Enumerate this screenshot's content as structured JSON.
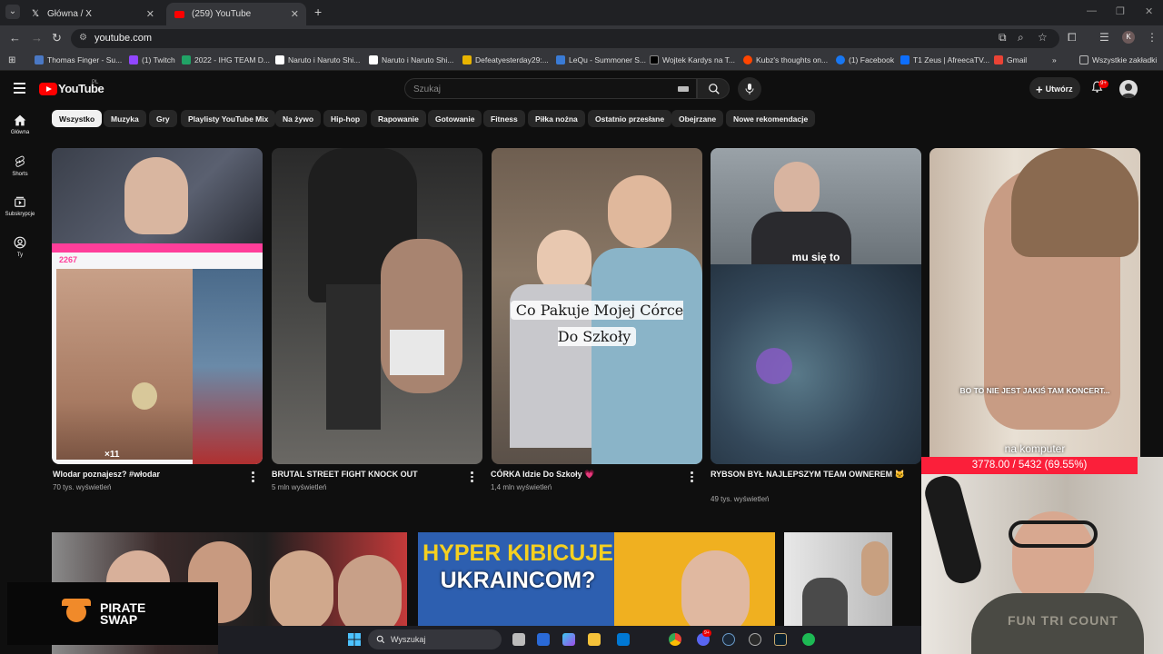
{
  "browser": {
    "tabs": [
      {
        "title": "Główna / X",
        "favicon": "x-logo-icon"
      },
      {
        "title": "(259) YouTube",
        "favicon": "youtube-icon"
      }
    ],
    "url": "youtube.com",
    "bookmarks": [
      "Thomas Finger - Su...",
      "(1) Twitch",
      "2022 - IHG TEAM D...",
      "Naruto i Naruto Shi...",
      "Naruto i Naruto Shi...",
      "Defeatyesterday29:...",
      "LeQu - Summoner S...",
      "Wojtek Kardys na T...",
      "Kubz's thoughts on...",
      "(1) Facebook",
      "T1 Zeus | AfreecaTV...",
      "Gmail"
    ],
    "all_bookmarks": "Wszystkie zakładki",
    "profile_initial": "K"
  },
  "youtube": {
    "logo_text": "YouTube",
    "region": "PL",
    "search_placeholder": "Szukaj",
    "create_label": "Utwórz",
    "notifications_badge": "9+",
    "sidebar": [
      {
        "label": "Główna",
        "icon": "home-icon"
      },
      {
        "label": "Shorts",
        "icon": "shorts-icon"
      },
      {
        "label": "Subskrypcje",
        "icon": "subscriptions-icon"
      },
      {
        "label": "Ty",
        "icon": "user-icon"
      }
    ],
    "chips": [
      "Wszystko",
      "Muzyka",
      "Gry",
      "Playlisty YouTube Mix",
      "Na żywo",
      "Hip-hop",
      "Rapowanie",
      "Gotowanie",
      "Fitness",
      "Piłka nożna",
      "Ostatnio przesłane",
      "Obejrzane",
      "Nowe rekomendacje"
    ],
    "shorts": [
      {
        "title": "Wlodar poznajesz? #włodar",
        "views": "70 tys. wyświetleń",
        "overlay": [
          "2267",
          "×11"
        ]
      },
      {
        "title": "BRUTAL STREET FIGHT KNOCK OUT",
        "views": "5 mln wyświetleń"
      },
      {
        "title": "CÓRKA Idzie Do Szkoły 💗",
        "views": "1,4 mln wyświetleń",
        "overlay_text": "Co Pakuje Mojej Córce Do Szkoły"
      },
      {
        "title": "RYBSON BYŁ NAJLEPSZYM TEAM OWNEREM 🐱",
        "views": "49 tys. wyświetleń",
        "overlay_text": "mu się to"
      },
      {
        "title": "",
        "views": "",
        "overlay_text": "BO TO NIE JEST JAKIŚ TAM KONCERT...",
        "overlay_text2": "na komputer"
      }
    ],
    "bottom_thumbs": [
      {
        "text": ""
      },
      {
        "text_line1": "HYPER KIBICUJE",
        "text_line2": "UKRAINCOM?"
      },
      {
        "text": ""
      }
    ]
  },
  "overlays": {
    "sponsor_line1": "PIRATE",
    "sponsor_line2": "SWAP",
    "counter": "3778.00 / 5432 (69.55%)",
    "shirt_text": "FUN TRI COUNT"
  },
  "taskbar": {
    "search_label": "Wyszukaj",
    "chat_badge": "9+"
  },
  "colors": {
    "accent_red": "#ff0000",
    "counter_bg": "#fb1f3a",
    "background": "#0f0f0f"
  }
}
